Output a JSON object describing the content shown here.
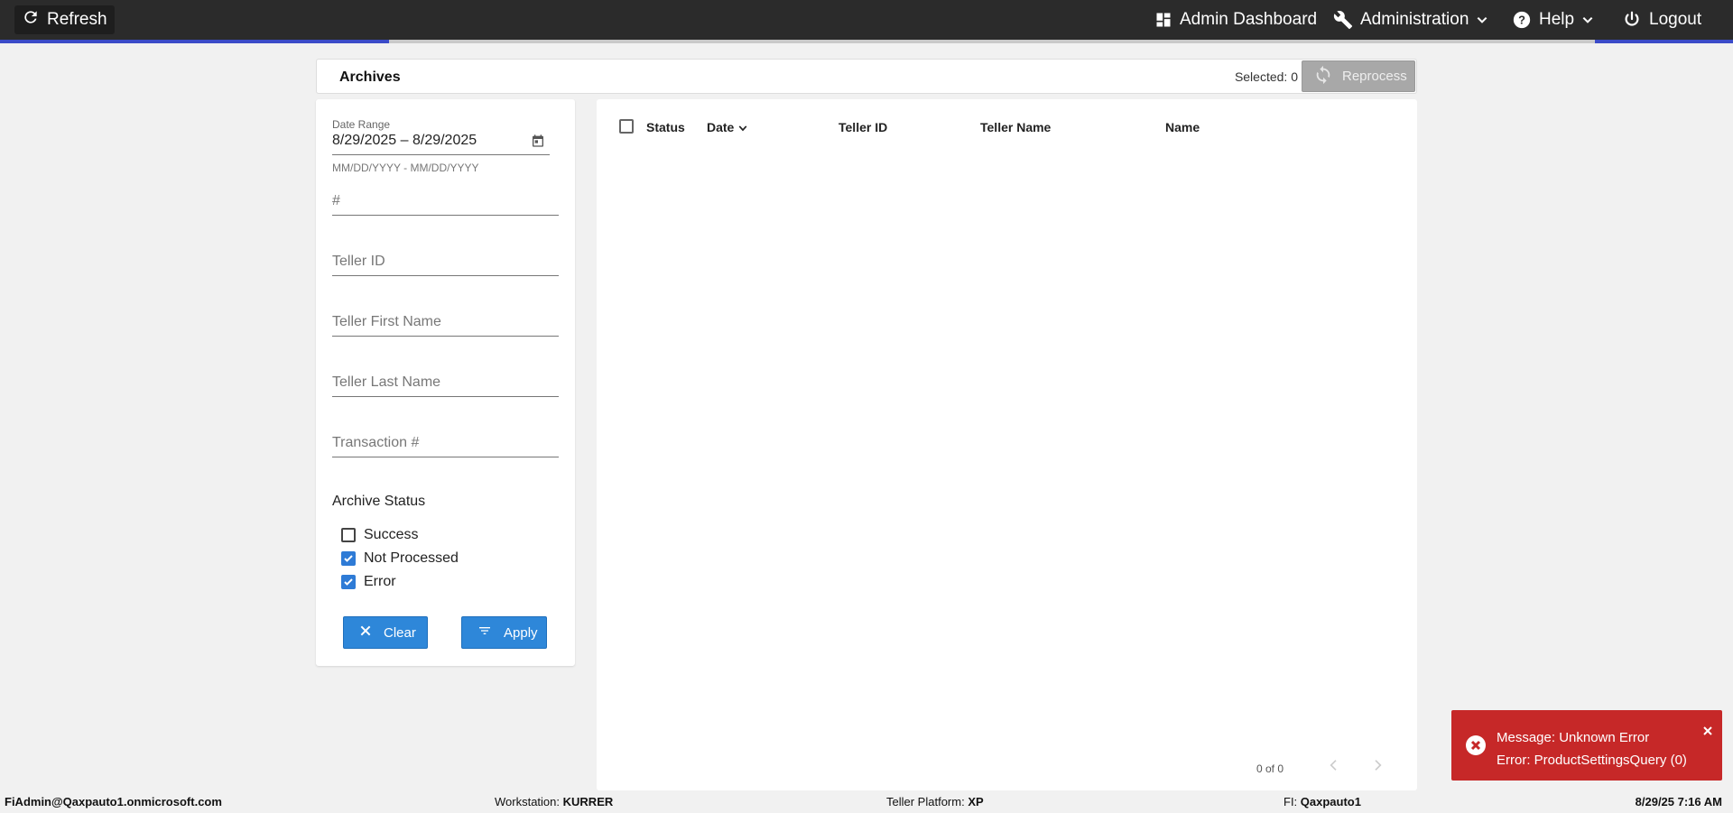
{
  "topbar": {
    "refresh_label": "Refresh",
    "admin_dashboard_label": "Admin Dashboard",
    "administration_label": "Administration",
    "help_label": "Help",
    "logout_label": "Logout",
    "accent_color": "#3b4bc8"
  },
  "header": {
    "title": "Archives",
    "selected_text": "Selected: 0",
    "reprocess_label": "Reprocess"
  },
  "filters": {
    "date_range_label": "Date Range",
    "date_range_value": "8/29/2025 – 8/29/2025",
    "date_hint": "MM/DD/YYYY - MM/DD/YYYY",
    "number_placeholder": "#",
    "teller_id_placeholder": "Teller ID",
    "teller_first_name_placeholder": "Teller First Name",
    "teller_last_name_placeholder": "Teller Last Name",
    "transaction_placeholder": "Transaction #",
    "archive_status_title": "Archive Status",
    "statuses": [
      {
        "label": "Success",
        "checked": false
      },
      {
        "label": "Not Processed",
        "checked": true
      },
      {
        "label": "Error",
        "checked": true
      }
    ],
    "clear_label": "Clear",
    "apply_label": "Apply"
  },
  "grid": {
    "columns": [
      "Status",
      "Date",
      "Teller ID",
      "Teller Name",
      "Name"
    ],
    "sort_column": "Date",
    "pager_text": "0 of 0"
  },
  "toast": {
    "line1": "Message: Unknown Error",
    "line2": "Error: ProductSettingsQuery (0)",
    "color": "#c62828"
  },
  "footer": {
    "user": "FiAdmin@Qaxpauto1.onmicrosoft.com",
    "workstation_label": "Workstation:",
    "workstation_value": "KURRER",
    "platform_label": "Teller Platform:",
    "platform_value": "XP",
    "fi_label": "FI:",
    "fi_value": "Qaxpauto1",
    "datetime": "8/29/25 7:16 AM"
  }
}
